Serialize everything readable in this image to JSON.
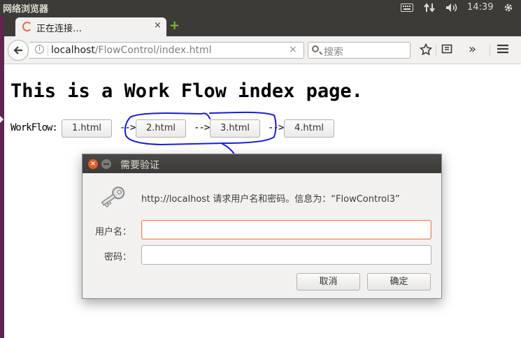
{
  "os_panel": {
    "app_title": "网络浏览器",
    "clock": "14:39"
  },
  "browser": {
    "tab": {
      "title": "正在连接…",
      "close_glyph": "×"
    },
    "new_tab_glyph": "+",
    "nav": {
      "url_host": "localhost",
      "url_path": "/FlowControl/index.html",
      "url_clear_glyph": "×",
      "search_placeholder": "搜索",
      "overflow_glyph": "»",
      "menu_glyph": "≡"
    }
  },
  "page": {
    "title": "This is a Work Flow index page.",
    "workflow_label": "WorkFlow:",
    "arrow": "-->",
    "steps": [
      {
        "label": "1.html"
      },
      {
        "label": "2.html"
      },
      {
        "label": "3.html"
      },
      {
        "label": "4.html"
      }
    ]
  },
  "auth_dialog": {
    "title": "需要验证",
    "message": "http://localhost 请求用户名和密码。信息为：“FlowControl3”",
    "username_label": "用户名：",
    "username_value": "",
    "password_label": "密码：",
    "password_value": "",
    "cancel_label": "取消",
    "ok_label": "确定"
  },
  "colors": {
    "panel_bg": "#3c3b37",
    "accent_orange": "#e25a2a",
    "focus_border": "#e9845a",
    "annotation_ink": "#1a1fd1"
  }
}
